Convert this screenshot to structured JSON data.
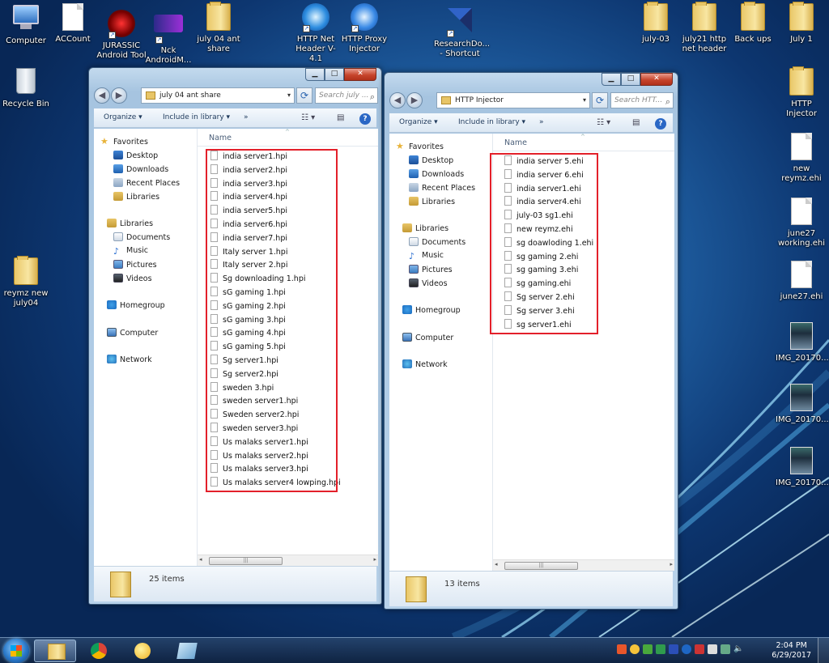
{
  "desktop": {
    "icons_left": [
      {
        "label": "Computer",
        "type": "computer"
      },
      {
        "label": "ACCount",
        "type": "file"
      },
      {
        "label": "JURASSIC\nAndroid Tool",
        "type": "app-jurassic"
      },
      {
        "label": "Nck\nAndroidM...",
        "type": "app-nck"
      },
      {
        "label": "july 04 ant\nshare",
        "type": "folder"
      },
      {
        "label": "HTTP Net\nHeader V-4.1",
        "type": "app-ssh"
      },
      {
        "label": "HTTP Proxy\nInjector",
        "type": "app-proxy"
      },
      {
        "label": "ResearchDo...\n- Shortcut",
        "type": "app-research"
      },
      {
        "label": "Recycle Bin",
        "type": "recycle"
      },
      {
        "label": "reymz new\njuly04",
        "type": "folder"
      }
    ],
    "icons_right": [
      {
        "label": "july-03",
        "type": "folder"
      },
      {
        "label": "july21 http\nnet header",
        "type": "folder"
      },
      {
        "label": "Back ups",
        "type": "folder"
      },
      {
        "label": "July 1",
        "type": "folder"
      },
      {
        "label": "HTTP\nInjector",
        "type": "folder"
      },
      {
        "label": "new\nreymz.ehi",
        "type": "file"
      },
      {
        "label": "june27\nworking.ehi",
        "type": "file"
      },
      {
        "label": "june27.ehi",
        "type": "file"
      },
      {
        "label": "IMG_20170...",
        "type": "image"
      },
      {
        "label": "IMG_20170...",
        "type": "image"
      },
      {
        "label": "IMG_20170...",
        "type": "image"
      }
    ]
  },
  "window_left": {
    "address": "july 04 ant share",
    "search_placeholder": "Search july ...",
    "toolbar": {
      "organize": "Organize ▾",
      "include": "Include in library ▾",
      "more": "»"
    },
    "column_name": "Name",
    "nav": {
      "favorites": "Favorites",
      "desktop": "Desktop",
      "downloads": "Downloads",
      "recent": "Recent Places",
      "libraries_fav": "Libraries",
      "libraries": "Libraries",
      "documents": "Documents",
      "music": "Music",
      "pictures": "Pictures",
      "videos": "Videos",
      "homegroup": "Homegroup",
      "computer": "Computer",
      "network": "Network"
    },
    "files": [
      "india server1.hpi",
      "india server2.hpi",
      "india server3.hpi",
      "india server4.hpi",
      "india server5.hpi",
      "india server6.hpi",
      "india server7.hpi",
      "Italy server 1.hpi",
      "Italy server 2.hpi",
      "Sg downloading 1.hpi",
      "sG gaming 1.hpi",
      "sG gaming 2.hpi",
      "sG gaming 3.hpi",
      "sG gaming 4.hpi",
      "sG gaming 5.hpi",
      "Sg server1.hpi",
      "Sg server2.hpi",
      "sweden 3.hpi",
      "sweden server1.hpi",
      "Sweden server2.hpi",
      "sweden server3.hpi",
      "Us malaks server1.hpi",
      "Us malaks server2.hpi",
      "Us malaks server3.hpi",
      "Us malaks server4 lowping.hpi"
    ],
    "item_count": "25 items"
  },
  "window_right": {
    "address": "HTTP Injector",
    "search_placeholder": "Search HTT...",
    "toolbar": {
      "organize": "Organize ▾",
      "include": "Include in library ▾",
      "more": "»"
    },
    "column_name": "Name",
    "nav": {
      "favorites": "Favorites",
      "desktop": "Desktop",
      "downloads": "Downloads",
      "recent": "Recent Places",
      "libraries_fav": "Libraries",
      "libraries": "Libraries",
      "documents": "Documents",
      "music": "Music",
      "pictures": "Pictures",
      "videos": "Videos",
      "homegroup": "Homegroup",
      "computer": "Computer",
      "network": "Network"
    },
    "files": [
      "india server 5.ehi",
      "india server 6.ehi",
      "india server1.ehi",
      "india server4.ehi",
      "july-03 sg1.ehi",
      "new reymz.ehi",
      "sg doawloding 1.ehi",
      "sg gaming 2.ehi",
      "sg gaming 3.ehi",
      "sg gaming.ehi",
      "Sg server 2.ehi",
      "Sg server 3.ehi",
      "sg server1.ehi"
    ],
    "item_count": "13 items"
  },
  "taskbar": {
    "time": "2:04 PM",
    "date": "6/29/2017"
  },
  "colors": {
    "highlight_box": "#e3202a",
    "accent": "#2a67c5"
  }
}
